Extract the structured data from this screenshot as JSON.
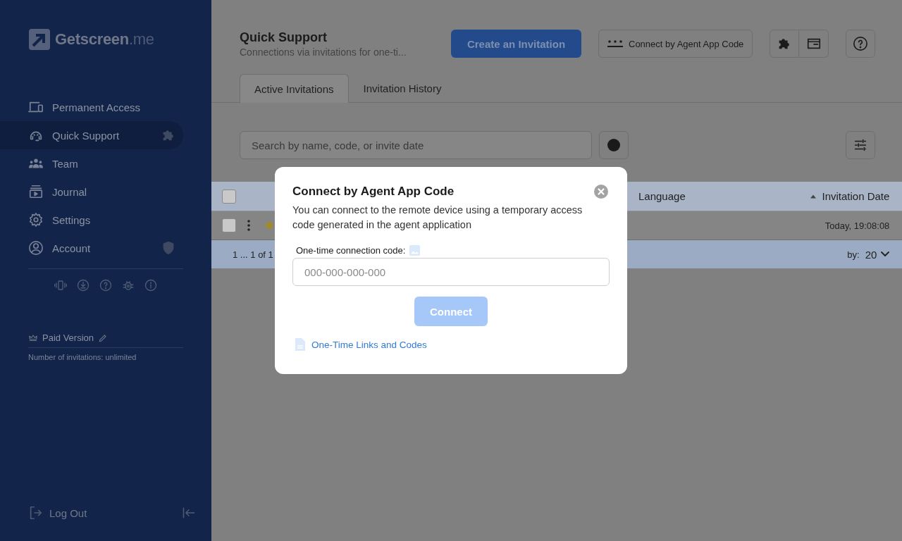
{
  "sidebar": {
    "logo": {
      "name": "Getscreen",
      "suffix": ".me"
    },
    "items": [
      {
        "label": "Permanent Access",
        "selected": false
      },
      {
        "label": "Quick Support",
        "selected": true
      },
      {
        "label": "Team",
        "selected": false
      },
      {
        "label": "Journal",
        "selected": false
      },
      {
        "label": "Settings",
        "selected": false
      },
      {
        "label": "Account",
        "selected": false
      }
    ],
    "plan": {
      "label": "Paid Version",
      "note": "Number of invitations: unlimited"
    },
    "logout": "Log Out"
  },
  "header": {
    "title": "Quick Support",
    "subtitle": "Connections via invitations for one-ti...",
    "create_button": "Create an Invitation",
    "code_button": "Connect by Agent App Code"
  },
  "tabs": [
    {
      "label": "Active Invitations",
      "selected": true
    },
    {
      "label": "Invitation History",
      "selected": false
    }
  ],
  "search": {
    "placeholder": "Search by name, code, or invite date"
  },
  "table": {
    "select_all_checked": false,
    "columns": [
      {
        "label": "Language",
        "sorted": false
      },
      {
        "label": "Invitation Date",
        "sorted": true
      }
    ],
    "rows": [
      {
        "checked": false,
        "color": "#a08a2a",
        "date": "Today, 19:08:08"
      }
    ],
    "footer": {
      "range": "1 ... 1 of 1",
      "per_page_label": "by:",
      "per_page": "20"
    }
  },
  "dialog": {
    "title": "Connect by Agent App Code",
    "text": "You can connect to the remote device using a temporary access code generated in the agent application",
    "field_label": "One-time connection code:",
    "placeholder": "000-000-000-000",
    "button": "Connect",
    "button_disabled": true,
    "link": "One-Time Links and Codes"
  }
}
